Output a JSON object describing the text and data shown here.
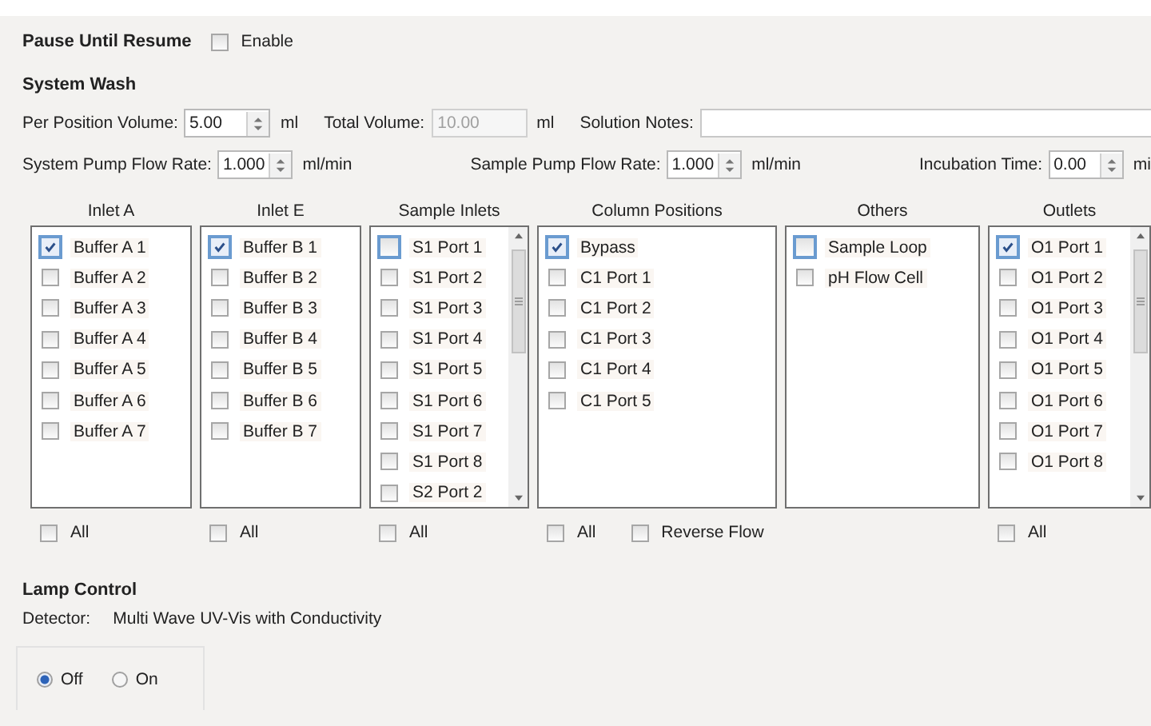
{
  "pause": {
    "title": "Pause Until Resume",
    "checkbox": {
      "label": "Enable",
      "checked": false
    }
  },
  "system_wash": {
    "title": "System Wash",
    "rows": [
      {
        "items": [
          {
            "kind": "label",
            "text": "Per Position Volume:"
          },
          {
            "kind": "spin",
            "value": "5.00"
          },
          {
            "kind": "unit",
            "text": "ml"
          },
          {
            "kind": "label",
            "text": "Total Volume:"
          },
          {
            "kind": "field",
            "value": "10.00",
            "disabled": true
          },
          {
            "kind": "unit",
            "text": "ml"
          },
          {
            "kind": "label",
            "text": "Solution Notes:"
          },
          {
            "kind": "wide"
          }
        ]
      },
      {
        "items": [
          {
            "kind": "label",
            "text": "System Pump Flow Rate:"
          },
          {
            "kind": "spin",
            "value": "1.000"
          },
          {
            "kind": "unit",
            "text": "ml/min"
          },
          {
            "kind": "label",
            "text": "Sample Pump Flow Rate:"
          },
          {
            "kind": "spin",
            "value": "1.000"
          },
          {
            "kind": "unit",
            "text": "ml/min"
          },
          {
            "kind": "label",
            "text": "Incubation Time:"
          },
          {
            "kind": "spin",
            "value": "0.00"
          },
          {
            "kind": "unit",
            "text": "mi"
          }
        ]
      }
    ]
  },
  "lists": [
    {
      "title": "Inlet A",
      "scrollbar": false,
      "items": [
        {
          "label": "Buffer A 1",
          "checked": true,
          "selected": true
        },
        {
          "label": "Buffer A 2",
          "checked": false,
          "selected": false
        },
        {
          "label": "Buffer A 3",
          "checked": false,
          "selected": false
        },
        {
          "label": "Buffer A 4",
          "checked": false,
          "selected": false
        },
        {
          "label": "Buffer A 5",
          "checked": false,
          "selected": false
        },
        {
          "label": "Buffer A 6",
          "checked": false,
          "selected": false
        },
        {
          "label": "Buffer A 7",
          "checked": false,
          "selected": false
        }
      ],
      "footer": [
        {
          "label": "All",
          "checked": false
        }
      ]
    },
    {
      "title": "Inlet E",
      "scrollbar": false,
      "items": [
        {
          "label": "Buffer B 1",
          "checked": true,
          "selected": true
        },
        {
          "label": "Buffer B 2",
          "checked": false,
          "selected": false
        },
        {
          "label": "Buffer B 3",
          "checked": false,
          "selected": false
        },
        {
          "label": "Buffer B 4",
          "checked": false,
          "selected": false
        },
        {
          "label": "Buffer B 5",
          "checked": false,
          "selected": false
        },
        {
          "label": "Buffer B 6",
          "checked": false,
          "selected": false
        },
        {
          "label": "Buffer B 7",
          "checked": false,
          "selected": false
        }
      ],
      "footer": [
        {
          "label": "All",
          "checked": false
        }
      ]
    },
    {
      "title": "Sample Inlets",
      "scrollbar": true,
      "items": [
        {
          "label": "S1 Port 1",
          "checked": false,
          "selected": true
        },
        {
          "label": "S1 Port 2",
          "checked": false,
          "selected": false
        },
        {
          "label": "S1 Port 3",
          "checked": false,
          "selected": false
        },
        {
          "label": "S1 Port 4",
          "checked": false,
          "selected": false
        },
        {
          "label": "S1 Port 5",
          "checked": false,
          "selected": false
        },
        {
          "label": "S1 Port 6",
          "checked": false,
          "selected": false
        },
        {
          "label": "S1 Port 7",
          "checked": false,
          "selected": false
        },
        {
          "label": "S1 Port 8",
          "checked": false,
          "selected": false
        },
        {
          "label": "S2 Port 2",
          "checked": false,
          "selected": false
        }
      ],
      "footer": [
        {
          "label": "All",
          "checked": false
        }
      ]
    },
    {
      "title": "Column Positions",
      "scrollbar": false,
      "items": [
        {
          "label": "Bypass",
          "checked": true,
          "selected": true
        },
        {
          "label": "C1 Port 1",
          "checked": false,
          "selected": false
        },
        {
          "label": "C1 Port 2",
          "checked": false,
          "selected": false
        },
        {
          "label": "C1 Port 3",
          "checked": false,
          "selected": false
        },
        {
          "label": "C1 Port 4",
          "checked": false,
          "selected": false
        },
        {
          "label": "C1 Port 5",
          "checked": false,
          "selected": false
        }
      ],
      "footer": [
        {
          "label": "All",
          "checked": false
        },
        {
          "label": "Reverse Flow",
          "checked": false
        }
      ]
    },
    {
      "title": "Others",
      "scrollbar": false,
      "items": [
        {
          "label": "Sample Loop",
          "checked": false,
          "selected": true
        },
        {
          "label": "pH Flow Cell",
          "checked": false,
          "selected": false
        }
      ]
    },
    {
      "title": "Outlets",
      "scrollbar": true,
      "items": [
        {
          "label": "O1 Port 1",
          "checked": true,
          "selected": true
        },
        {
          "label": "O1 Port 2",
          "checked": false,
          "selected": false
        },
        {
          "label": "O1 Port 3",
          "checked": false,
          "selected": false
        },
        {
          "label": "O1 Port 4",
          "checked": false,
          "selected": false
        },
        {
          "label": "O1 Port 5",
          "checked": false,
          "selected": false
        },
        {
          "label": "O1 Port 6",
          "checked": false,
          "selected": false
        },
        {
          "label": "O1 Port 7",
          "checked": false,
          "selected": false
        },
        {
          "label": "O1 Port 8",
          "checked": false,
          "selected": false
        }
      ],
      "footer": [
        {
          "label": "All",
          "checked": false
        }
      ]
    }
  ],
  "lamp": {
    "title": "Lamp Control",
    "detector_label": "Detector:",
    "detector_value": "Multi Wave UV-Vis with Conductivity",
    "radios": [
      {
        "label": "Off",
        "selected": true
      },
      {
        "label": "On",
        "selected": false
      }
    ]
  }
}
